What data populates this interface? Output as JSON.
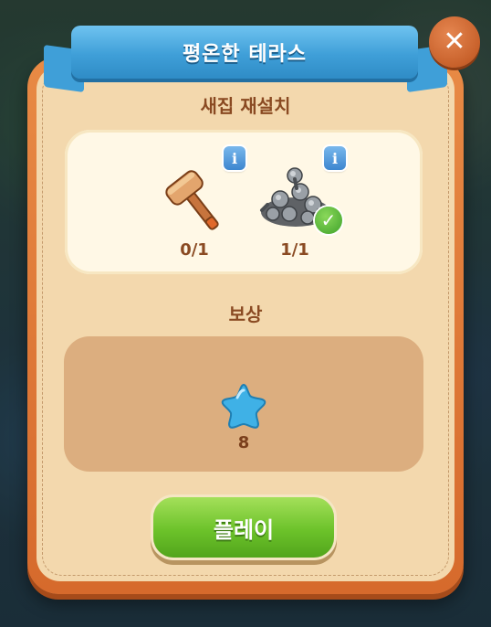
{
  "dialog": {
    "title": "평온한 테라스",
    "task_label": "새집 재설치",
    "reward_label": "보상",
    "play_label": "플레이",
    "close_symbol": "✕"
  },
  "requirements": [
    {
      "icon": "hammer-icon",
      "count": "0/1",
      "completed": false
    },
    {
      "icon": "screws-icon",
      "count": "1/1",
      "completed": true
    }
  ],
  "reward": {
    "icon": "blue-star-icon",
    "amount": "8"
  },
  "colors": {
    "ribbon": "#3f9fd8",
    "panel_border": "#d66a2c",
    "panel_bg": "#f3d8ad",
    "play_button": "#6cc22a",
    "reward_star": "#3fb1e6",
    "text_brown": "#8a4a22"
  }
}
